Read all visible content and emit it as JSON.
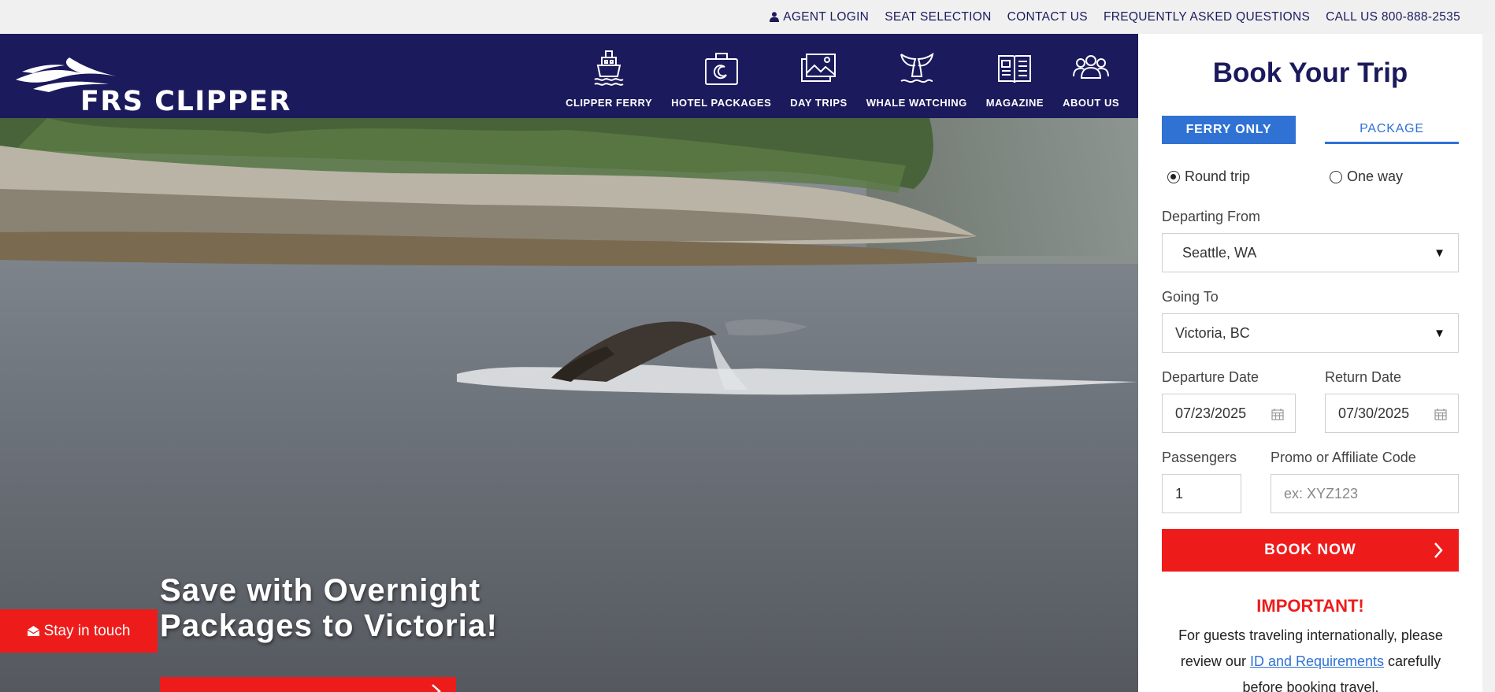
{
  "topnav": {
    "agent_login": "AGENT LOGIN",
    "seat_selection": "SEAT SELECTION",
    "contact_us": "CONTACT US",
    "faq": "FREQUENTLY ASKED QUESTIONS",
    "call_us": "CALL US 800-888-2535"
  },
  "brand": {
    "name": "FRS CLIPPER"
  },
  "mainnav": {
    "items": [
      {
        "label": "CLIPPER FERRY",
        "icon": "ferry-icon"
      },
      {
        "label": "HOTEL PACKAGES",
        "icon": "suitcase-icon"
      },
      {
        "label": "DAY TRIPS",
        "icon": "photos-icon"
      },
      {
        "label": "WHALE WATCHING",
        "icon": "whale-tail-icon"
      },
      {
        "label": "MAGAZINE",
        "icon": "magazine-icon"
      },
      {
        "label": "ABOUT US",
        "icon": "people-icon"
      }
    ]
  },
  "hero": {
    "title": "Save with Overnight Packages to Victoria!"
  },
  "stay_in_touch": "Stay in touch",
  "booking": {
    "title": "Book Your Trip",
    "tab_ferry": "FERRY ONLY",
    "tab_package": "PACKAGE",
    "round_trip": "Round trip",
    "one_way": "One way",
    "departing_label": "Departing From",
    "departing_value": "Seattle, WA",
    "going_label": "Going To",
    "going_value": "Victoria, BC",
    "departure_label": "Departure Date",
    "departure_value": "07/23/2025",
    "return_label": "Return Date",
    "return_value": "07/30/2025",
    "passengers_label": "Passengers",
    "passengers_value": "1",
    "promo_label": "Promo or Affiliate Code",
    "promo_placeholder": "ex: XYZ123",
    "book_now": "BOOK NOW",
    "important": "IMPORTANT!",
    "notice_before": "For guests traveling internationally, please review our ",
    "notice_link": "ID and Requirements",
    "notice_after": " carefully before booking travel."
  },
  "colors": {
    "navy": "#1b1a5c",
    "blue": "#2f72d4",
    "red": "#ee1b1b"
  }
}
